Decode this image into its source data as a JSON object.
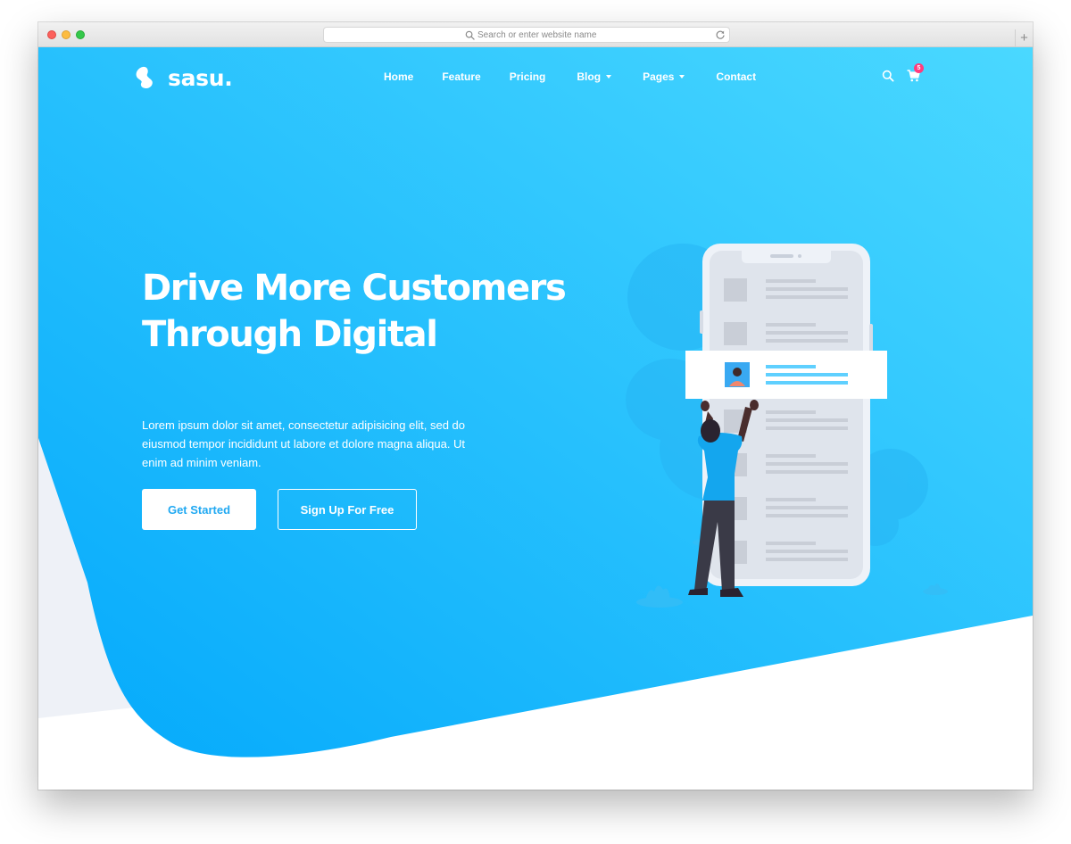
{
  "browser": {
    "url_placeholder": "Search or enter website name",
    "new_tab_label": "+"
  },
  "brand": {
    "name": "sasu."
  },
  "nav": {
    "items": [
      {
        "label": "Home",
        "has_dropdown": false
      },
      {
        "label": "Feature",
        "has_dropdown": false
      },
      {
        "label": "Pricing",
        "has_dropdown": false
      },
      {
        "label": "Blog",
        "has_dropdown": true
      },
      {
        "label": "Pages",
        "has_dropdown": true
      },
      {
        "label": "Contact",
        "has_dropdown": false
      }
    ],
    "cart_count": "5",
    "icons": [
      "search-icon",
      "cart-icon"
    ]
  },
  "hero": {
    "title_line1": "Drive More Customers",
    "title_line2": "Through Digital",
    "desc_line1": "Lorem ipsum dolor sit amet, consectetur adipisicing elit, sed do",
    "desc_line2": "eiusmod tempor incididunt ut labore et dolore magna aliqua. Ut",
    "desc_line3": "enim ad minim veniam.",
    "primary_button": "Get Started",
    "secondary_button": "Sign Up For Free"
  },
  "colors": {
    "hero_gradient_start": "#04a9fb",
    "hero_gradient_end": "#4ad8ff",
    "accent": "#21a9f2",
    "badge": "#ff3c7e",
    "white": "#ffffff"
  }
}
